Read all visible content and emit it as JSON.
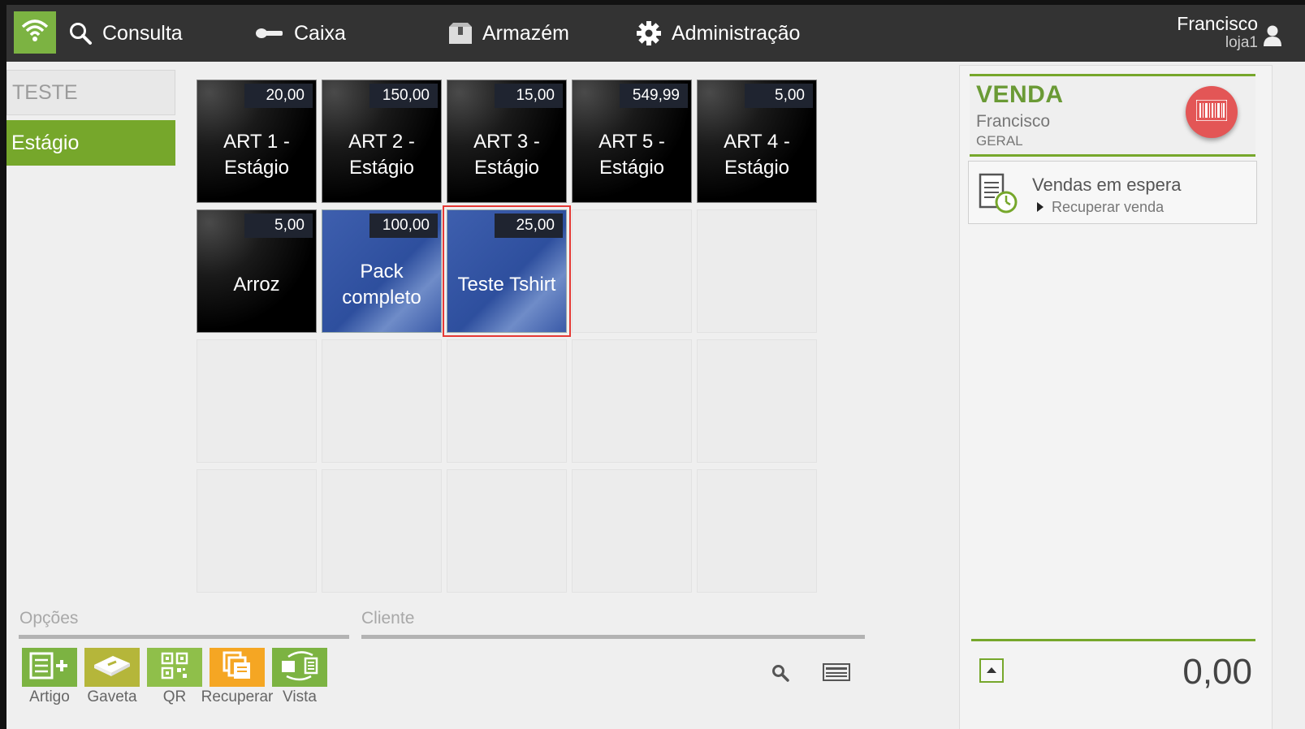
{
  "topbar": {
    "nav": [
      {
        "label": "Consulta",
        "icon": "search-icon"
      },
      {
        "label": "Caixa",
        "icon": "key-icon"
      },
      {
        "label": "Armazém",
        "icon": "box-icon"
      },
      {
        "label": "Administração",
        "icon": "gear-icon"
      }
    ],
    "user": {
      "name": "Francisco",
      "store": "loja1"
    }
  },
  "categories": [
    {
      "label": "TESTE",
      "active": false
    },
    {
      "label": "Estágio",
      "active": true
    }
  ],
  "tiles": [
    {
      "price": "20,00",
      "label": "ART 1 - Estágio",
      "style": "black"
    },
    {
      "price": "150,00",
      "label": "ART 2 - Estágio",
      "style": "black"
    },
    {
      "price": "15,00",
      "label": "ART 3 - Estágio",
      "style": "black"
    },
    {
      "price": "549,99",
      "label": "ART 5 - Estágio",
      "style": "black"
    },
    {
      "price": "5,00",
      "label": "ART 4 - Estágio",
      "style": "black"
    },
    {
      "price": "5,00",
      "label": "Arroz",
      "style": "black"
    },
    {
      "price": "100,00",
      "label": "Pack completo",
      "style": "blue"
    },
    {
      "price": "25,00",
      "label": "Teste Tshirt",
      "style": "blue",
      "selected": true
    }
  ],
  "options": {
    "title": "Opções",
    "buttons": [
      {
        "label": "Artigo",
        "color": "#7cb342"
      },
      {
        "label": "Gaveta",
        "color": "#b5b63a"
      },
      {
        "label": "QR",
        "color": "#8fbf4a"
      },
      {
        "label": "Recuperar",
        "color": "#f5a623"
      },
      {
        "label": "Vista",
        "color": "#7cb342"
      }
    ]
  },
  "cliente": {
    "title": "Cliente"
  },
  "sale": {
    "title": "VENDA",
    "user": "Francisco",
    "group": "GERAL",
    "waiting_title": "Vendas em espera",
    "waiting_action": "Recuperar venda",
    "total": "0,00"
  },
  "colors": {
    "accent": "#76a72b",
    "topbar": "#333333",
    "selected_border": "#e53935"
  }
}
